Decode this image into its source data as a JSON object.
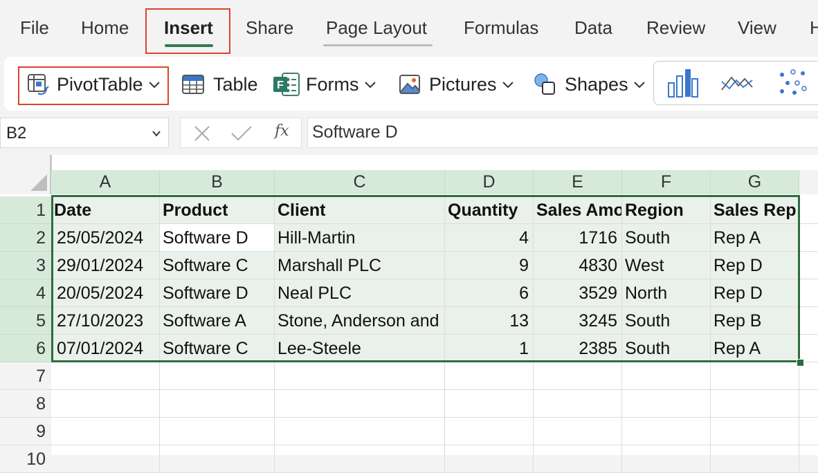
{
  "menu": {
    "tabs": [
      "File",
      "Home",
      "Insert",
      "Share",
      "Page Layout",
      "Formulas",
      "Data",
      "Review",
      "View",
      "H"
    ],
    "active": "Insert"
  },
  "ribbon": {
    "pivottable": "PivotTable",
    "table": "Table",
    "forms": "Forms",
    "pictures": "Pictures",
    "shapes": "Shapes"
  },
  "formula_bar": {
    "name_box": "B2",
    "fx": "fx",
    "content": "Software D"
  },
  "sheet": {
    "columns": [
      "A",
      "B",
      "C",
      "D",
      "E",
      "F",
      "G"
    ],
    "row_numbers": [
      "1",
      "2",
      "3",
      "4",
      "5",
      "6",
      "7",
      "8",
      "9",
      "10"
    ],
    "headers": [
      "Date",
      "Product",
      "Client",
      "Quantity",
      "Sales Amo",
      "Region",
      "Sales Rep"
    ],
    "rows": [
      [
        "25/05/2024",
        "Software D",
        "Hill-Martin",
        "4",
        "1716",
        "South",
        "Rep A"
      ],
      [
        "29/01/2024",
        "Software C",
        "Marshall PLC",
        "9",
        "4830",
        "West",
        "Rep D"
      ],
      [
        "20/05/2024",
        "Software D",
        "Neal PLC",
        "6",
        "3529",
        "North",
        "Rep D"
      ],
      [
        "27/10/2023",
        "Software A",
        "Stone, Anderson and",
        "13",
        "3245",
        "South",
        "Rep B"
      ],
      [
        "07/01/2024",
        "Software C",
        "Lee-Steele",
        "1",
        "2385",
        "South",
        "Rep A"
      ]
    ],
    "active_cell": "B2",
    "selected_range": "A1:G6"
  },
  "colors": {
    "accent_green": "#2f7b4f",
    "highlight_red": "#d9442c",
    "selection_fill": "#e9f1ea",
    "header_selected": "#d7ead9"
  }
}
